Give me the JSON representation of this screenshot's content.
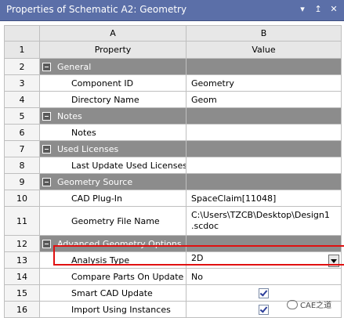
{
  "window": {
    "title": "Properties of Schematic A2: Geometry",
    "btn_menu": "▾",
    "btn_pin": "↥",
    "btn_close": "✕"
  },
  "grid": {
    "columns": [
      "A",
      "B"
    ],
    "header_row_num": "1",
    "header_property": "Property",
    "header_value": "Value",
    "rows": [
      {
        "num": "2",
        "type": "section",
        "label": "General"
      },
      {
        "num": "3",
        "type": "prop",
        "label": "Component ID",
        "value": "Geometry"
      },
      {
        "num": "4",
        "type": "prop",
        "label": "Directory Name",
        "value": "Geom"
      },
      {
        "num": "5",
        "type": "section",
        "label": "Notes"
      },
      {
        "num": "6",
        "type": "prop",
        "label": "Notes",
        "value": ""
      },
      {
        "num": "7",
        "type": "section",
        "label": "Used Licenses"
      },
      {
        "num": "8",
        "type": "prop",
        "label": "Last Update Used Licenses",
        "value": ""
      },
      {
        "num": "9",
        "type": "section",
        "label": "Geometry Source"
      },
      {
        "num": "10",
        "type": "prop",
        "label": "CAD Plug-In",
        "value": "SpaceClaim[11048]"
      },
      {
        "num": "11",
        "type": "prop",
        "label": "Geometry File Name",
        "value": "C:\\Users\\TZCB\\Desktop\\Design1.scdoc",
        "value_line1": "C:\\Users\\TZCB\\Desktop\\Design1",
        "value_line2": ".scdoc"
      },
      {
        "num": "12",
        "type": "section",
        "label": "Advanced Geometry Options"
      },
      {
        "num": "13",
        "type": "dropdown",
        "label": "Analysis Type",
        "value": "2D"
      },
      {
        "num": "14",
        "type": "dropdown",
        "label": "Compare Parts On Update",
        "value": "No"
      },
      {
        "num": "15",
        "type": "checkbox",
        "label": "Smart CAD Update",
        "checked": true
      },
      {
        "num": "16",
        "type": "checkbox",
        "label": "Import Using Instances",
        "checked": true
      }
    ]
  },
  "watermark": {
    "text": "CAE之道"
  }
}
